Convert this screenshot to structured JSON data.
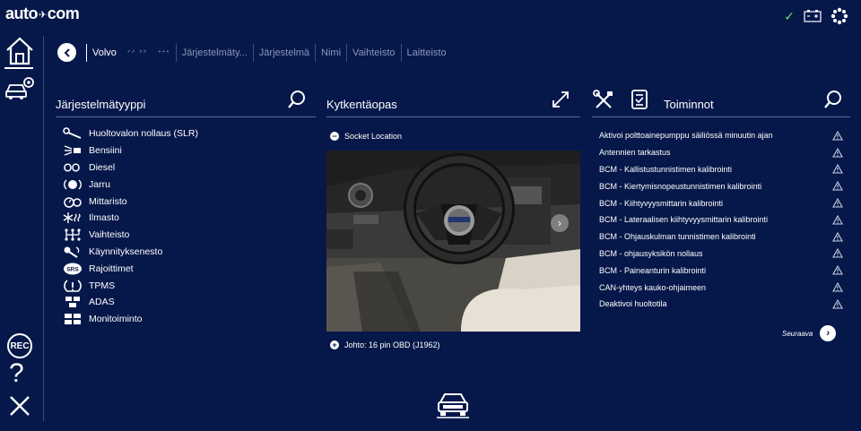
{
  "app": {
    "logo_left": "auto",
    "logo_mark": "✈",
    "logo_right": "com"
  },
  "breadcrumb": {
    "items": [
      {
        "label": "Volvo",
        "active": true
      },
      {
        "label": "ᐟᐟ ᐣᐣ",
        "glyph": true
      },
      {
        "label": "ᐩᐩᐩ",
        "glyph": true
      },
      {
        "label": "Järjestelmäty...",
        "active": false
      },
      {
        "label": "Järjestelmä",
        "active": false
      },
      {
        "label": "Nimi",
        "active": false
      },
      {
        "label": "Vaihteisto",
        "active": false
      },
      {
        "label": "Laitteisto",
        "active": false
      }
    ]
  },
  "left_panel": {
    "title": "Järjestelmätyyppi",
    "items": [
      {
        "label": "Huoltovalon nollaus (SLR)",
        "icon": "wrench-icon"
      },
      {
        "label": "Bensiini",
        "icon": "fuel-spray-icon"
      },
      {
        "label": "Diesel",
        "icon": "glow-plug-icon"
      },
      {
        "label": "Jarru",
        "icon": "brake-icon"
      },
      {
        "label": "Mittaristo",
        "icon": "gauge-icon"
      },
      {
        "label": "Ilmasto",
        "icon": "climate-icon"
      },
      {
        "label": "Vaihteisto",
        "icon": "gearbox-icon"
      },
      {
        "label": "Käynnityksenesto",
        "icon": "immobilizer-key-icon"
      },
      {
        "label": "Rajoittimet",
        "icon": "srs-icon"
      },
      {
        "label": "TPMS",
        "icon": "tpms-icon"
      },
      {
        "label": "ADAS",
        "icon": "adas-icon"
      },
      {
        "label": "Monitoiminto",
        "icon": "multifunction-icon"
      }
    ]
  },
  "middle_panel": {
    "title": "Kytkentäopas",
    "socket_label": "Socket Location",
    "socket_toggle": "−",
    "wire_label": "Johto: 16 pin OBD (J1962)",
    "wire_toggle": "+",
    "next_arrow": "›"
  },
  "right_panel": {
    "title": "Toiminnot",
    "items": [
      "Aktivoi polttoainepumppu säiliössä minuutin ajan",
      "Antennien tarkastus",
      "BCM - Kallistustunnistimen kalibrointi",
      "BCM - Kiertymisnopeustunnistimen kalibrointi",
      "BCM - Kiihtyvyysmittarin kalibrointi",
      "BCM - Lateraalisen kiihtyvyysmittarin kalibrointi",
      "BCM - Ohjauskulman tunnistimen kalibrointi",
      "BCM - ohjausyksikön nollaus",
      "BCM - Paineanturin kalibrointi",
      "CAN-yhteys kauko-ohjaimeen",
      "Deaktivoi huoltotila"
    ],
    "next_label": "Seuraava",
    "next_arrow": "›"
  },
  "rail": {
    "rec_label": "REC",
    "help_label": "?"
  },
  "status": {
    "check": "✓"
  },
  "colors": {
    "background": "#06184a",
    "rule": "#5a6a99",
    "muted_text": "#8b96b8",
    "ok_green": "#7ddc6a"
  }
}
